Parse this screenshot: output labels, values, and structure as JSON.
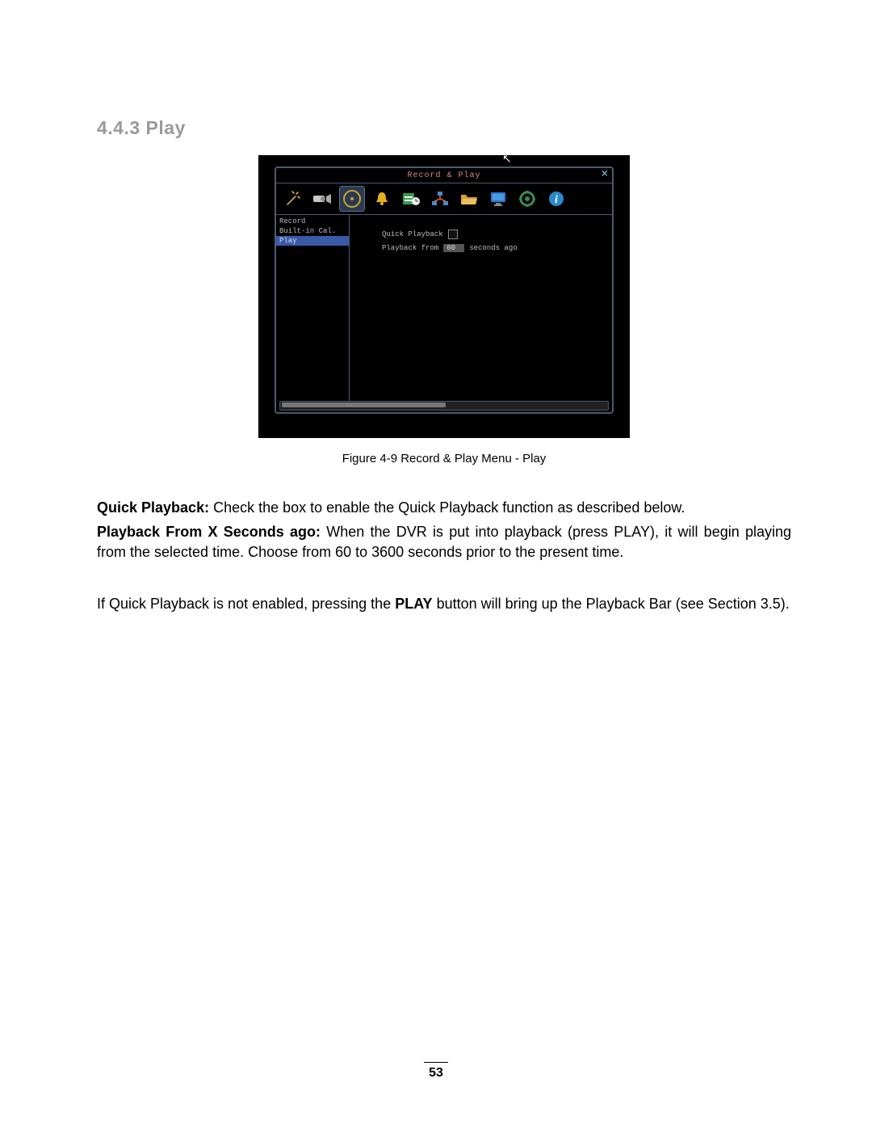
{
  "heading": "4.4.3 Play",
  "dvr": {
    "title": "Record & Play",
    "sidebar": {
      "items": [
        {
          "label": "Record"
        },
        {
          "label": "Built-in Cal."
        },
        {
          "label": "Play"
        }
      ]
    },
    "content": {
      "quick_label": "Quick Playback",
      "from_label_pre": "Playback from",
      "from_value": "60",
      "from_label_post": "seconds ago"
    },
    "toolbar_icons": [
      "wand-icon",
      "camera-icon",
      "reel-icon",
      "bell-icon",
      "schedule-icon",
      "network-icon",
      "folder-icon",
      "monitor-icon",
      "gear-icon",
      "info-icon"
    ]
  },
  "caption": "Figure 4-9 Record & Play Menu - Play",
  "para1": {
    "lead": "Quick Playback:",
    "rest": " Check the box to enable the Quick Playback function as described below."
  },
  "para2": {
    "lead": "Playback From X Seconds ago:",
    "rest": " When the DVR is put into playback (press PLAY), it will begin playing from the selected time. Choose from 60 to 3600 seconds prior to the present time."
  },
  "para3": {
    "pre": "If Quick Playback is not enabled, pressing the ",
    "bold": "PLAY",
    "post": " button will bring up the Playback Bar (see Section 3.5)."
  },
  "page_number": "53"
}
